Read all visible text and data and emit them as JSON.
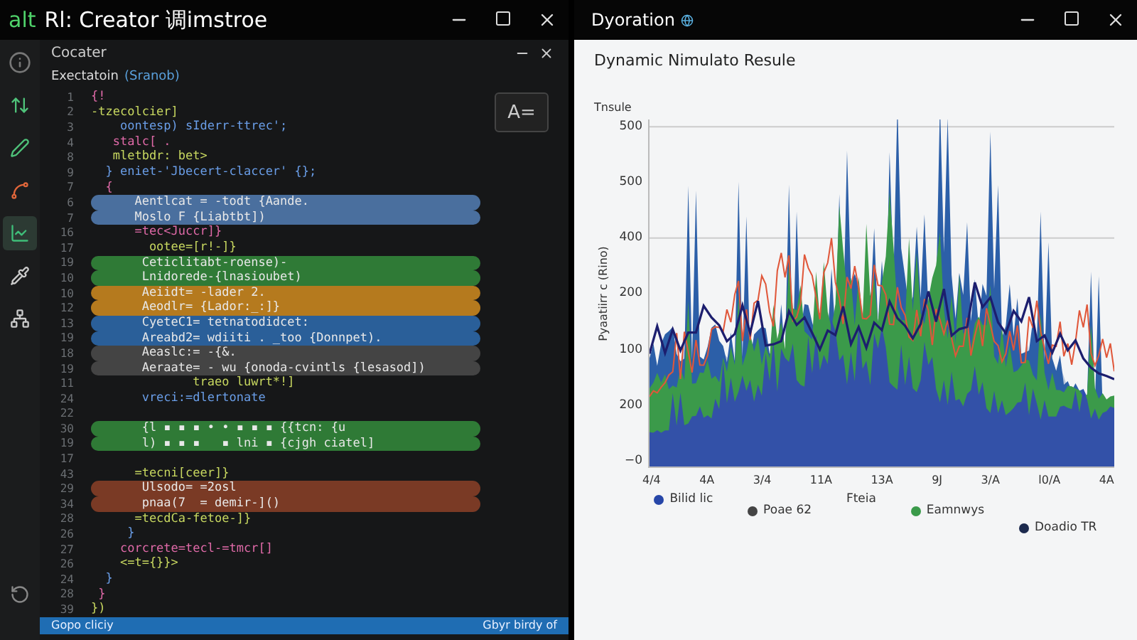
{
  "editor_window": {
    "title_prefix": "alt",
    "title": "Rl: Creator 调imstroe",
    "tab": "Cocater",
    "file_header": "Exectatoin",
    "file_header_note": "(Sranob)",
    "badge": "A=",
    "activity": [
      {
        "kind": "arrows",
        "selected": false
      },
      {
        "kind": "pen",
        "selected": false
      },
      {
        "kind": "shape",
        "selected": false
      },
      {
        "kind": "chart",
        "selected": true
      },
      {
        "kind": "pipette",
        "selected": false
      },
      {
        "kind": "nodes",
        "selected": false
      }
    ],
    "lines": [
      {
        "number": "1",
        "text": "{!"
      },
      {
        "number": "2",
        "text": "-tzecolcier]"
      },
      {
        "number": "3",
        "text": "    oontesp) sIderr-ttrec';"
      },
      {
        "number": "4",
        "text": "   stalc[ ."
      },
      {
        "number": "8",
        "text": "   mletbdr: bet>"
      },
      {
        "number": "9",
        "text": "  } eniet-'Jbecert-claccer' {};"
      },
      {
        "number": "7",
        "text": "  {"
      },
      {
        "number": "6",
        "text": "      Aentlcat = -todt {Aande.",
        "color": "#4a6f9e"
      },
      {
        "number": "7",
        "text": "      Moslo F {Liabtbt])",
        "color": "#4a6f9e"
      },
      {
        "number": "16",
        "text": "      =tec<Juccr]}"
      },
      {
        "number": "17",
        "text": "        ootee=[r!-]}"
      },
      {
        "number": "19",
        "text": "       Ceticlitabt-roense)-",
        "color": "#2f7a36"
      },
      {
        "number": "10",
        "text": "       Lnidorede-{lnasioubet)",
        "color": "#2f7a36"
      },
      {
        "number": "10",
        "text": "       Aeiidt= -lader 2.",
        "color": "#b57a1e"
      },
      {
        "number": "12",
        "text": "       Aeodlr= {Lador:_:]}",
        "color": "#b57a1e"
      },
      {
        "number": "13",
        "text": "       CyeteC1= tetnatodidcet:",
        "color": "#2a5f99"
      },
      {
        "number": "19",
        "text": "       Areabd2= wdiiti . _too {Donnpet).",
        "color": "#2a5f99"
      },
      {
        "number": "18",
        "text": "       Aeaslc:= -{&.",
        "color": "#444444"
      },
      {
        "number": "19",
        "text": "       Aeraate= - wu {onoda-cvintls {lesasod])",
        "color": "#444444"
      },
      {
        "number": "11",
        "text": "              traeo luwrt*!]"
      },
      {
        "number": "24",
        "text": "       vreci:=dlertonate"
      },
      {
        "number": "22"
      },
      {
        "number": "30",
        "text": "       {l ▪ ▪ ▪ • • ▪ ▪ ▪ {{tcn: {u",
        "color": "#2f7a36"
      },
      {
        "number": "19",
        "text": "       l) ▪ ▪ ▪   ▪ lni ▪ {cjgh ciatel]",
        "color": "#2f7a36"
      },
      {
        "number": "17"
      },
      {
        "number": "43",
        "text": "      =tecni[ceer]}"
      },
      {
        "number": "29",
        "text": "       Ulsodo= =2osl",
        "color": "#7a3a25"
      },
      {
        "number": "34",
        "text": "       pnaa(7  = demir-]()",
        "color": "#7a3a25"
      },
      {
        "number": "28",
        "text": "      =tecdCa-fetoe-]}"
      },
      {
        "number": "26",
        "text": "     }"
      },
      {
        "number": "27",
        "text": "    corcrete=tecl-=tmcr[]"
      },
      {
        "number": "26",
        "text": "    <=t={}}>"
      },
      {
        "number": "24",
        "text": "  }"
      },
      {
        "number": "28",
        "text": " }"
      },
      {
        "number": "39",
        "text": "})"
      }
    ],
    "status_left": "Gopo cliciy",
    "status_right": "Gbyr birdy of"
  },
  "chart_window": {
    "title": "Dyoration",
    "heading": "Dynamic Nimulato Resule",
    "top_label": "Tnsule",
    "y_label": "Pyaatiirr c (Rino)",
    "y_ticks": [
      "500",
      "500",
      "400",
      "200",
      "100",
      "200",
      "−0"
    ],
    "x_labels": [
      "4/4",
      "4A",
      "3/4",
      "11A",
      "13A",
      "9J",
      "3/A",
      "l0/A",
      "4A"
    ],
    "legend": [
      {
        "label": "Bilid lic",
        "color": "#2646a8"
      },
      {
        "label": "Poae 62",
        "color": "#444444"
      },
      {
        "label": "Fteia"
      },
      {
        "label": "Eamnwys",
        "color": "#3a9a4a"
      },
      {
        "label": "Doadio TR",
        "color": "#1c2a4e"
      }
    ]
  }
}
